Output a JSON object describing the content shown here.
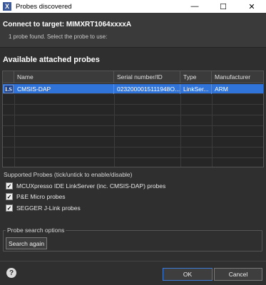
{
  "window": {
    "title": "Probes discovered",
    "app_icon_glyph": "X",
    "minimize": "—",
    "maximize": "☐",
    "close": "✕"
  },
  "header": {
    "title": "Connect to target: MIMXRT1064xxxxA",
    "subtitle": "1 probe found. Select the probe to use:"
  },
  "probes": {
    "title": "Available attached probes",
    "columns": [
      "Name",
      "Serial number/ID",
      "Type",
      "Manufacturer"
    ],
    "rows": [
      {
        "icon": "LS",
        "name": "CMSIS-DAP",
        "serial": "0232000015111948O...",
        "type": "LinkSer...",
        "manufacturer": "ARM",
        "selected": true
      }
    ]
  },
  "supported": {
    "label": "Supported Probes (tick/untick to enable/disable)",
    "items": [
      {
        "label": "MCUXpresso IDE LinkServer (inc. CMSIS-DAP) probes",
        "checked": true
      },
      {
        "label": "P&E Micro probes",
        "checked": true
      },
      {
        "label": "SEGGER J-Link probes",
        "checked": true
      }
    ]
  },
  "search": {
    "legend": "Probe search options",
    "button": "Search again"
  },
  "footer": {
    "help": "?",
    "ok": "OK",
    "cancel": "Cancel"
  }
}
